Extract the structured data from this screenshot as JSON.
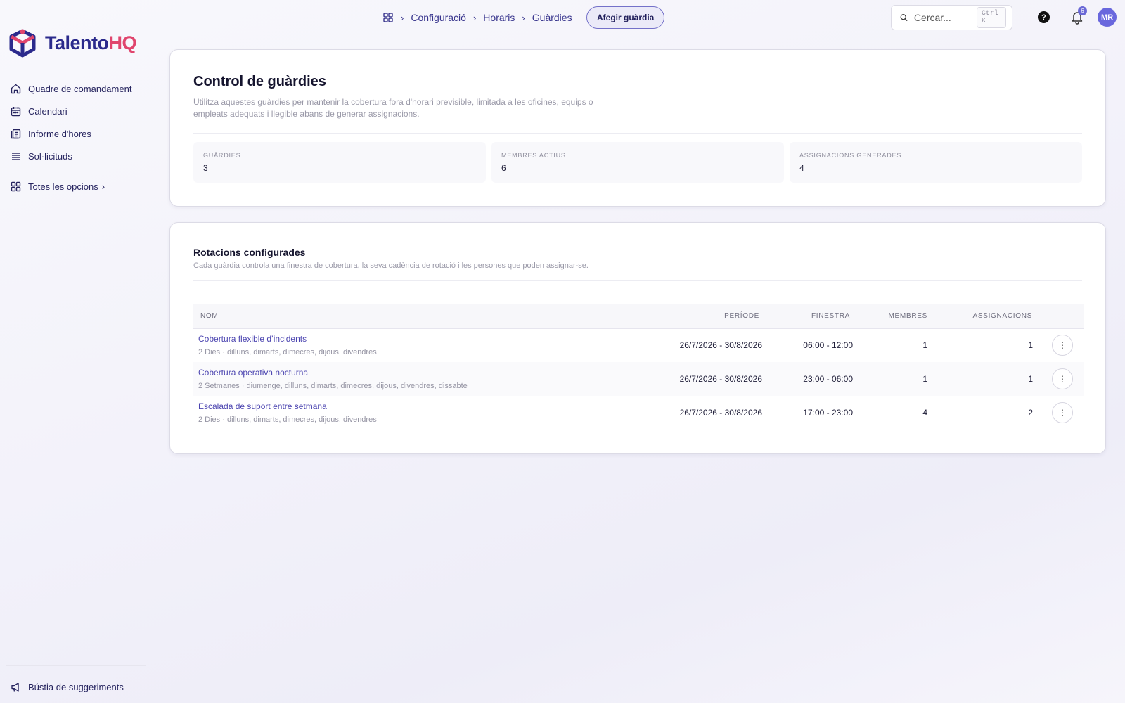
{
  "app": {
    "brand_part1": "Talento",
    "brand_part2": "HQ",
    "brand_colors": {
      "primary": "#2b2a8c",
      "secondary": "#e0456d"
    }
  },
  "sidebar": {
    "items": [
      {
        "label": "Quadre de comandament",
        "icon": "home-icon"
      },
      {
        "label": "Calendari",
        "icon": "calendar-icon"
      },
      {
        "label": "Informe d'hores",
        "icon": "timesheet-icon"
      },
      {
        "label": "Sol·licituds",
        "icon": "list-icon"
      }
    ],
    "all_options_label": "Totes les opcions",
    "feedback_label": "Bústia de suggeriments"
  },
  "topbar": {
    "breadcrumbs": [
      "Configuració",
      "Horaris",
      "Guàrdies"
    ],
    "add_button_label": "Afegir guàrdia",
    "search_placeholder": "Cercar...",
    "search_shortcut": "Ctrl K",
    "help_label": "?",
    "notification_count": "6",
    "avatar_initials": "MR"
  },
  "overview": {
    "title": "Control de guàrdies",
    "description": "Utilitza aquestes guàrdies per mantenir la cobertura fora d'horari previsible, limitada a les oficines, equips o empleats adequats i llegible abans de generar assignacions.",
    "stats": [
      {
        "label": "Guàrdies",
        "value": "3"
      },
      {
        "label": "Membres actius",
        "value": "6"
      },
      {
        "label": "Assignacions generades",
        "value": "4"
      }
    ]
  },
  "rotations": {
    "title": "Rotacions configurades",
    "description": "Cada guàrdia controla una finestra de cobertura, la seva cadència de rotació i les persones que poden assignar-se.",
    "columns": {
      "name": "Nom",
      "period": "Període",
      "window": "Finestra",
      "members": "Membres",
      "assignments": "Assignacions"
    },
    "rows": [
      {
        "name": "Cobertura flexible d’incidents",
        "detail": "2 Dies · dilluns, dimarts, dimecres, dijous, divendres",
        "period": "26/7/2026 - 30/8/2026",
        "window": "06:00 - 12:00",
        "members": "1",
        "assignments": "1"
      },
      {
        "name": "Cobertura operativa nocturna",
        "detail": "2 Setmanes · diumenge, dilluns, dimarts, dimecres, dijous, divendres, dissabte",
        "period": "26/7/2026 - 30/8/2026",
        "window": "23:00 - 06:00",
        "members": "1",
        "assignments": "1"
      },
      {
        "name": "Escalada de suport entre setmana",
        "detail": "2 Dies · dilluns, dimarts, dimecres, dijous, divendres",
        "period": "26/7/2026 - 30/8/2026",
        "window": "17:00 - 23:00",
        "members": "4",
        "assignments": "2"
      }
    ]
  }
}
